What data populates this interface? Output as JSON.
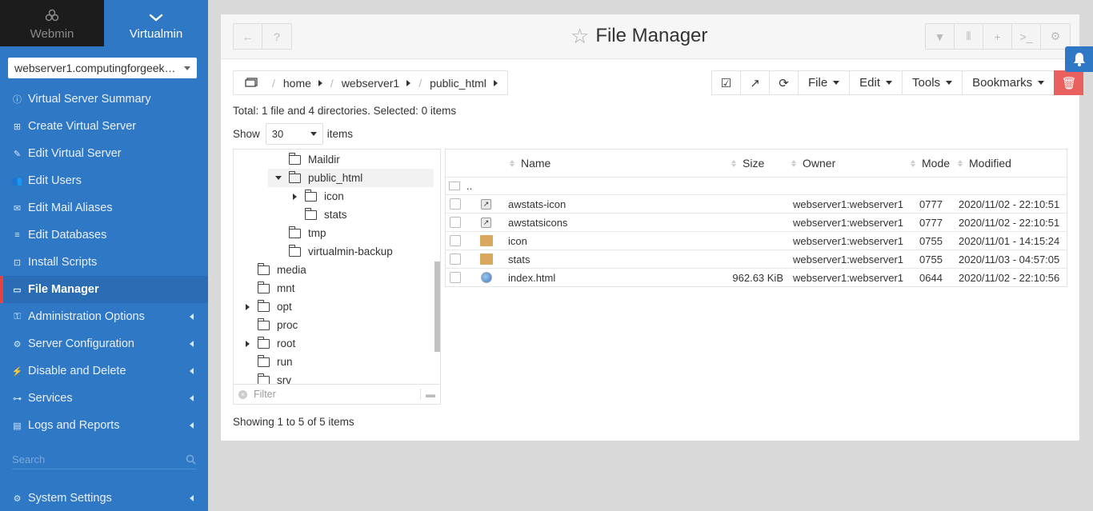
{
  "sidebar": {
    "tabs": [
      {
        "label": "Webmin"
      },
      {
        "label": "Virtualmin"
      }
    ],
    "server_select": "webserver1.computingforgeek…",
    "items": [
      {
        "label": "Virtual Server Summary",
        "icon": "info-icon"
      },
      {
        "label": "Create Virtual Server",
        "icon": "plus-square-icon"
      },
      {
        "label": "Edit Virtual Server",
        "icon": "edit-icon"
      },
      {
        "label": "Edit Users",
        "icon": "users-icon"
      },
      {
        "label": "Edit Mail Aliases",
        "icon": "envelope-icon"
      },
      {
        "label": "Edit Databases",
        "icon": "database-icon"
      },
      {
        "label": "Install Scripts",
        "icon": "install-icon"
      },
      {
        "label": "File Manager",
        "icon": "folder-open-icon",
        "active": true
      },
      {
        "label": "Administration Options",
        "icon": "key-icon"
      },
      {
        "label": "Server Configuration",
        "icon": "cogs-icon"
      },
      {
        "label": "Disable and Delete",
        "icon": "plug-icon"
      },
      {
        "label": "Services",
        "icon": "sitemap-icon"
      },
      {
        "label": "Logs and Reports",
        "icon": "file-text-icon"
      }
    ],
    "search_placeholder": "Search",
    "system_settings": "System Settings"
  },
  "panel": {
    "title": "File Manager",
    "breadcrumb": [
      "home",
      "webserver1",
      "public_html"
    ],
    "toolbar": {
      "file": "File",
      "edit": "Edit",
      "tools": "Tools",
      "bookmarks": "Bookmarks"
    },
    "summary": "Total: 1 file and 4 directories. Selected: 0 items",
    "show": {
      "label_before": "Show",
      "value": "30",
      "label_after": "items"
    },
    "tree": [
      {
        "name": "Maildir",
        "expand": "none"
      },
      {
        "name": "public_html",
        "expand": "open",
        "selected": true
      },
      {
        "name": "icon",
        "expand": "closed"
      },
      {
        "name": "stats",
        "expand": "none"
      },
      {
        "name": "tmp",
        "expand": "none"
      },
      {
        "name": "virtualmin-backup",
        "expand": "none"
      },
      {
        "name": "media",
        "expand": "none"
      },
      {
        "name": "mnt",
        "expand": "none"
      },
      {
        "name": "opt",
        "expand": "closed"
      },
      {
        "name": "proc",
        "expand": "none"
      },
      {
        "name": "root",
        "expand": "closed"
      },
      {
        "name": "run",
        "expand": "none"
      },
      {
        "name": "srv",
        "expand": "none"
      }
    ],
    "filter_placeholder": "Filter",
    "table": {
      "headers": {
        "name": "Name",
        "size": "Size",
        "owner": "Owner",
        "mode": "Mode",
        "modified": "Modified"
      },
      "up": "..",
      "rows": [
        {
          "name": "awstats-icon",
          "type": "link",
          "size": "",
          "owner": "webserver1:webserver1",
          "mode": "0777",
          "modified": "2020/11/02 - 22:10:51"
        },
        {
          "name": "awstatsicons",
          "type": "link",
          "size": "",
          "owner": "webserver1:webserver1",
          "mode": "0777",
          "modified": "2020/11/02 - 22:10:51"
        },
        {
          "name": "icon",
          "type": "folder",
          "size": "",
          "owner": "webserver1:webserver1",
          "mode": "0755",
          "modified": "2020/11/01 - 14:15:24"
        },
        {
          "name": "stats",
          "type": "folder",
          "size": "",
          "owner": "webserver1:webserver1",
          "mode": "0755",
          "modified": "2020/11/03 - 04:57:05"
        },
        {
          "name": "index.html",
          "type": "html",
          "size": "962.63 KiB",
          "owner": "webserver1:webserver1",
          "mode": "0644",
          "modified": "2020/11/02 - 22:10:56"
        }
      ]
    },
    "showing": "Showing 1 to 5 of 5 items"
  }
}
